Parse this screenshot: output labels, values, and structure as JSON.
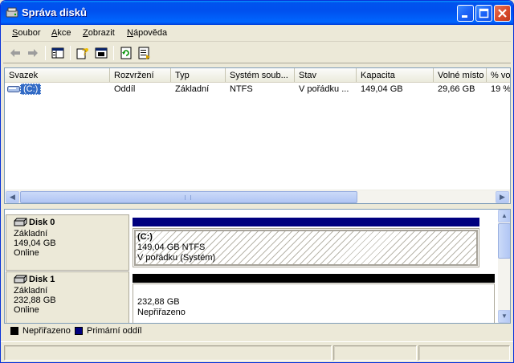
{
  "window": {
    "title": "Správa disků",
    "colors": {
      "title_bar": "#0053ee",
      "selection": "#316ac5",
      "primary_partition": "#00007f",
      "unallocated": "#000000"
    }
  },
  "menu": [
    {
      "label": "Soubor",
      "accel": "S",
      "rest": "oubor"
    },
    {
      "label": "Akce",
      "accel": "A",
      "rest": "kce"
    },
    {
      "label": "Zobrazit",
      "accel": "Z",
      "rest": "obrazit"
    },
    {
      "label": "Nápověda",
      "accel": "N",
      "rest": "ápověda"
    }
  ],
  "toolbar": {
    "icons": [
      "back-arrow-icon",
      "forward-arrow-icon",
      "show-hide-tree-icon",
      "help-icon",
      "properties-icon",
      "refresh-icon",
      "export-list-icon"
    ]
  },
  "volume_list": {
    "columns": [
      "Svazek",
      "Rozvržení",
      "Typ",
      "Systém soub...",
      "Stav",
      "Kapacita",
      "Volné místo",
      "% vo"
    ],
    "rows": [
      {
        "volume": "(C:)",
        "layout": "Oddíl",
        "type": "Základní",
        "fs": "NTFS",
        "status": "V pořádku ...",
        "capacity": "149,04 GB",
        "free": "29,66 GB",
        "pct_free": "19 %"
      }
    ]
  },
  "disks": [
    {
      "name": "Disk 0",
      "type": "Základní",
      "size": "149,04 GB",
      "state": "Online",
      "partition": {
        "name": "(C:)",
        "size_fs": "149,04 GB NTFS",
        "status": "V pořádku (Systém)",
        "kind": "primary"
      }
    },
    {
      "name": "Disk 1",
      "type": "Základní",
      "size": "232,88 GB",
      "state": "Online",
      "partition": {
        "size": "232,88 GB",
        "status": "Nepřiřazeno",
        "kind": "unallocated"
      }
    }
  ],
  "legend": [
    {
      "label": "Nepřiřazeno",
      "color": "#000000"
    },
    {
      "label": "Primární oddíl",
      "color": "#00007f"
    }
  ]
}
